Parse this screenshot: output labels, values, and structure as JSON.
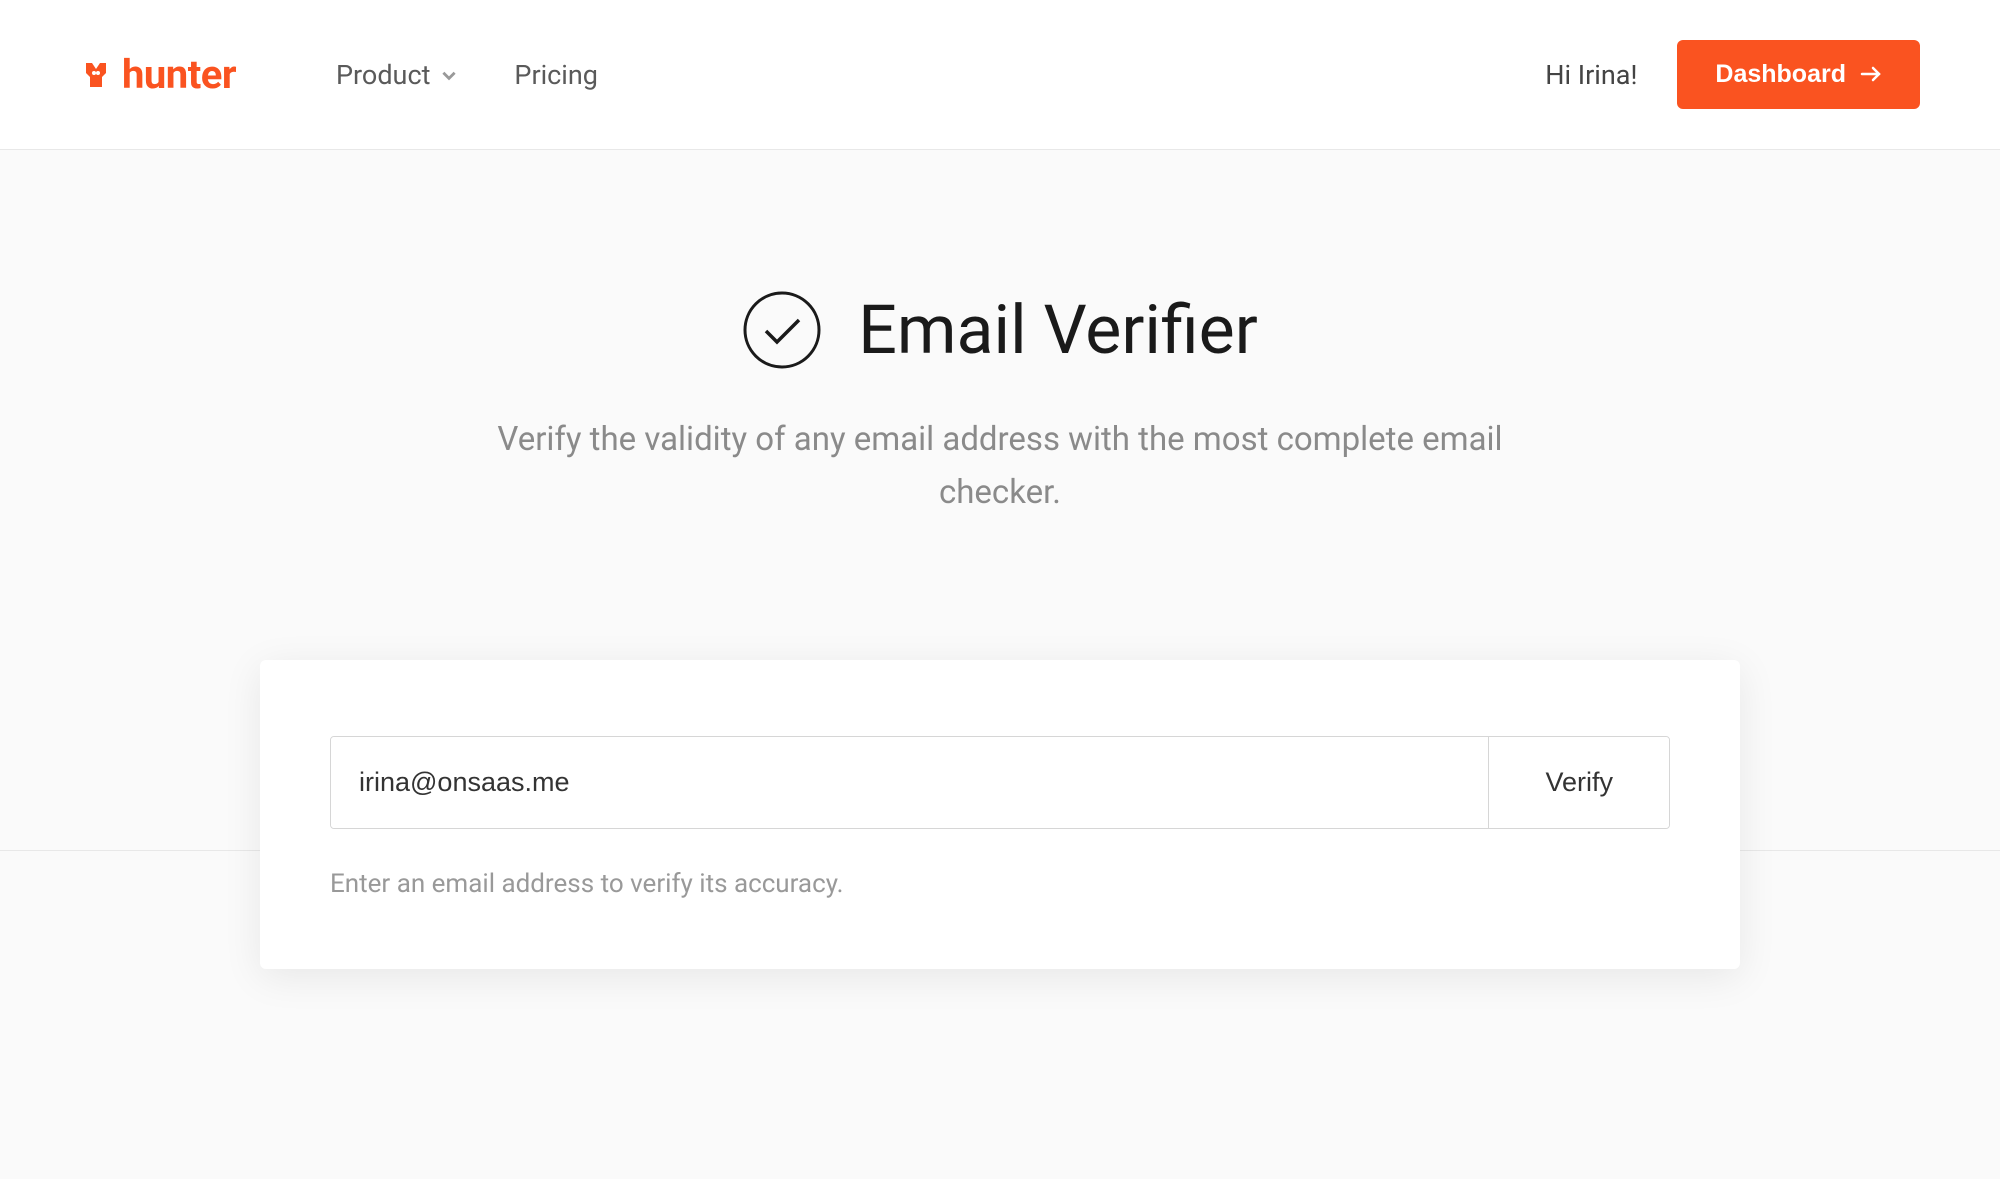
{
  "header": {
    "logo_text": "hunter",
    "nav": {
      "product_label": "Product",
      "pricing_label": "Pricing"
    },
    "greeting": "Hi Irina!",
    "dashboard_label": "Dashboard"
  },
  "hero": {
    "title": "Email Verifier",
    "subtitle": "Verify the validity of any email address with the most complete email checker."
  },
  "form": {
    "email_value": "irina@onsaas.me",
    "verify_label": "Verify",
    "hint": "Enter an email address to verify its accuracy."
  },
  "colors": {
    "brand": "#fa5320"
  }
}
